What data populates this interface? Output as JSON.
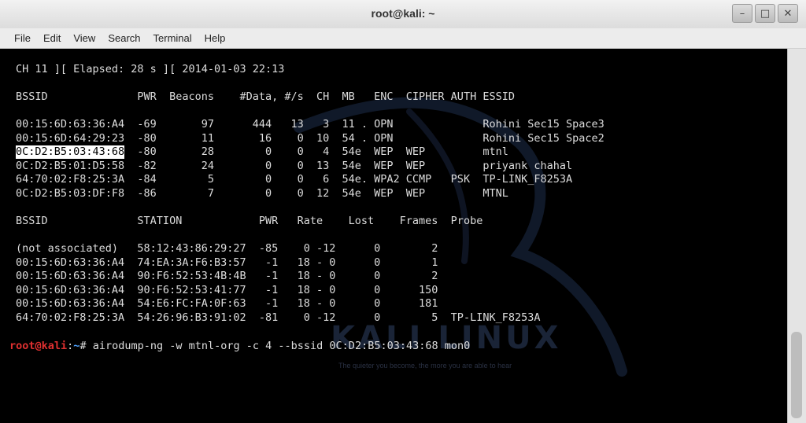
{
  "window": {
    "title": "root@kali: ~",
    "minimize": "–",
    "maximize": "□",
    "close": "✕"
  },
  "menu": [
    "File",
    "Edit",
    "View",
    "Search",
    "Terminal",
    "Help"
  ],
  "terminal": {
    "status": "CH 11 ][ Elapsed: 28 s ][ 2014-01-03 22:13",
    "ap_header": "BSSID              PWR  Beacons    #Data, #/s  CH  MB   ENC  CIPHER AUTH ESSID",
    "ap_rows": [
      "00:15:6D:63:36:A4  -69       97      444   13   3  11 . OPN              Rohini Sec15 Space3",
      "00:15:6D:64:29:23  -80       11       16    0  10  54 . OPN              Rohini Sec15 Space2",
      "0C:D2:B5:03:43:68  -80       28        0    0   4  54e  WEP  WEP         mtnl",
      "0C:D2:B5:01:D5:58  -82       24        0    0  13  54e  WEP  WEP         priyank chahal",
      "64:70:02:F8:25:3A  -84        5        0    0   6  54e. WPA2 CCMP   PSK  TP-LINK_F8253A",
      "0C:D2:B5:03:DF:F8  -86        7        0    0  12  54e  WEP  WEP         MTNL"
    ],
    "selected_bssid": "0C:D2:B5:03:43:68",
    "sta_header": "BSSID              STATION            PWR   Rate    Lost    Frames  Probe",
    "sta_rows": [
      "(not associated)   58:12:43:86:29:27  -85    0 -12      0        2",
      "00:15:6D:63:36:A4  74:EA:3A:F6:B3:57   -1   18 - 0      0        1",
      "00:15:6D:63:36:A4  90:F6:52:53:4B:4B   -1   18 - 0      0        2",
      "00:15:6D:63:36:A4  90:F6:52:53:41:77   -1   18 - 0      0      150",
      "00:15:6D:63:36:A4  54:E6:FC:FA:0F:63   -1   18 - 0      0      181",
      "64:70:02:F8:25:3A  54:26:96:B3:91:02  -81    0 -12      0        5  TP-LINK_F8253A"
    ],
    "prompt_user": "root@kali",
    "prompt_sep": ":",
    "prompt_path": "~",
    "prompt_symbol": "# ",
    "command": "airodump-ng -w mtnl-org -c 4 --bssid 0C:D2:B5:03:43:68 mon0"
  },
  "watermark": {
    "logo": "KALI LINUX",
    "tagline": "The quieter you become, the more you are able to hear"
  },
  "colors": {
    "terminal_bg": "#000000",
    "terminal_fg": "#dddddd",
    "prompt_user": "#e03030",
    "prompt_path": "#4fa3ff"
  }
}
